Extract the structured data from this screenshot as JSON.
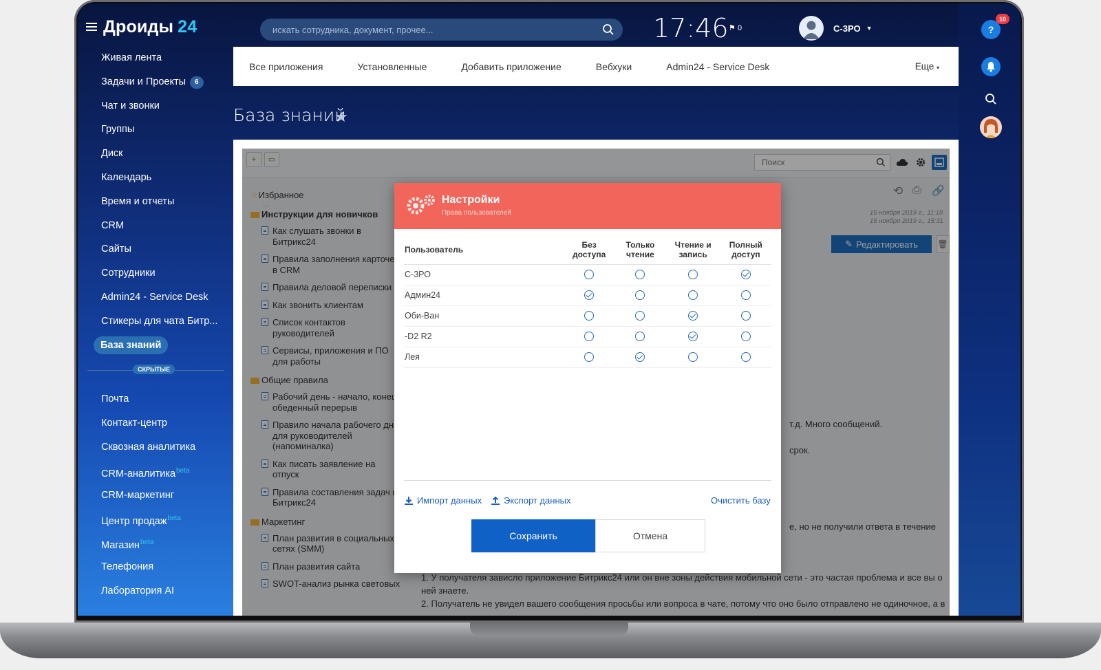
{
  "app": {
    "logo_text": "Дроиды",
    "logo_num": "24"
  },
  "header": {
    "search_placeholder": "искать сотрудника, документ, прочее...",
    "clock": "17:46",
    "flag_count": "0",
    "user_name": "С-3РО",
    "help_badge": "10"
  },
  "sidebar": {
    "items": [
      {
        "label": "Живая лента"
      },
      {
        "label": "Задачи и Проекты",
        "counter": "6"
      },
      {
        "label": "Чат и звонки"
      },
      {
        "label": "Группы"
      },
      {
        "label": "Диск"
      },
      {
        "label": "Календарь"
      },
      {
        "label": "Время и отчеты"
      },
      {
        "label": "CRM"
      },
      {
        "label": "Сайты"
      },
      {
        "label": "Сотрудники"
      },
      {
        "label": "Admin24 - Service Desk"
      },
      {
        "label": "Стикеры для чата Битр..."
      },
      {
        "label": "База знаний",
        "active": true
      }
    ],
    "hidden_label": "СКРЫТЫЕ",
    "hidden_items": [
      {
        "label": "Почта"
      },
      {
        "label": "Контакт-центр"
      },
      {
        "label": "Сквозная аналитика"
      },
      {
        "label": "CRM-аналитика",
        "sup": "beta"
      },
      {
        "label": "CRM-маркетинг"
      },
      {
        "label": "Центр продаж",
        "sup": "beta"
      },
      {
        "label": "Магазин",
        "sup": "beta"
      },
      {
        "label": "Телефония"
      },
      {
        "label": "Лаборатория AI"
      }
    ]
  },
  "tabs": [
    "Все приложения",
    "Установленные",
    "Добавить приложение",
    "Вебхуки",
    "Admin24 - Service Desk"
  ],
  "tabs_more": "Еще",
  "page_title": "База знаний",
  "kb": {
    "search_placeholder": "Поиск",
    "tree": {
      "favorites": "Избранное",
      "favorites_dots": "...",
      "group1": "Инструкции для новичков",
      "group1_docs": [
        "Как слушать звонки в Битрикс24",
        "Правила заполнения карточек в CRM",
        "Правила деловой переписки",
        "Как звонить клиентам",
        "Список контактов руководителей",
        "Сервисы, приложения и ПО для работы"
      ],
      "group2": "Общие правила",
      "group2_docs": [
        "Рабочий день - начало, конец, обеденный перерыв",
        "Правило начала рабочего дня для руководителей (напоминалка)",
        "Как писать заявление на отпуск",
        "Правила составления задач в Битрикс24"
      ],
      "group3": "Маркетинг",
      "group3_docs": [
        "План развития в социальных сетях (SMM)",
        "План развития сайта",
        "SWOT-анализ рынка световых"
      ]
    },
    "dates": [
      "15 ноября 2019 г., 11:18",
      "15 ноября 2019 г., 15:31"
    ],
    "edit_label": "Редактировать",
    "body_fragments": {
      "t1": "т.д. Много сообщений.",
      "t2": "срок.",
      "t3": "е, но не получили ответа в течение",
      "t4": "1. У получателя зависло приложение Битрикс24 или он вне зоны действия мобильной сети - это частая проблема и все вы о",
      "t5": "ней знаете.",
      "t6": "2. Получатель не увидел вашего сообщения просьбы или вопроса в чате, потому что оно было отправлено не одиночное, а в"
    }
  },
  "dialog": {
    "title": "Настройки",
    "subtitle": "Права пользователей",
    "columns": {
      "user": "Пользователь",
      "c1": "Без доступа",
      "c2": "Только чтение",
      "c3": "Чтение и запись",
      "c4": "Полный доступ"
    },
    "rows": [
      {
        "name": "С-3РО",
        "level": 4
      },
      {
        "name": "Админ24",
        "level": 1
      },
      {
        "name": "Оби-Ван",
        "level": 3
      },
      {
        "name": "-D2 R2",
        "level": 3
      },
      {
        "name": "Лея",
        "level": 2
      }
    ],
    "import_label": "Импорт данных",
    "export_label": "Экспорт данных",
    "clear_label": "Очистить базу",
    "save_label": "Сохранить",
    "cancel_label": "Отмена"
  },
  "colors": {
    "accent": "#1061c6",
    "dialog_header": "#f1655a",
    "badge": "#f03b43"
  }
}
